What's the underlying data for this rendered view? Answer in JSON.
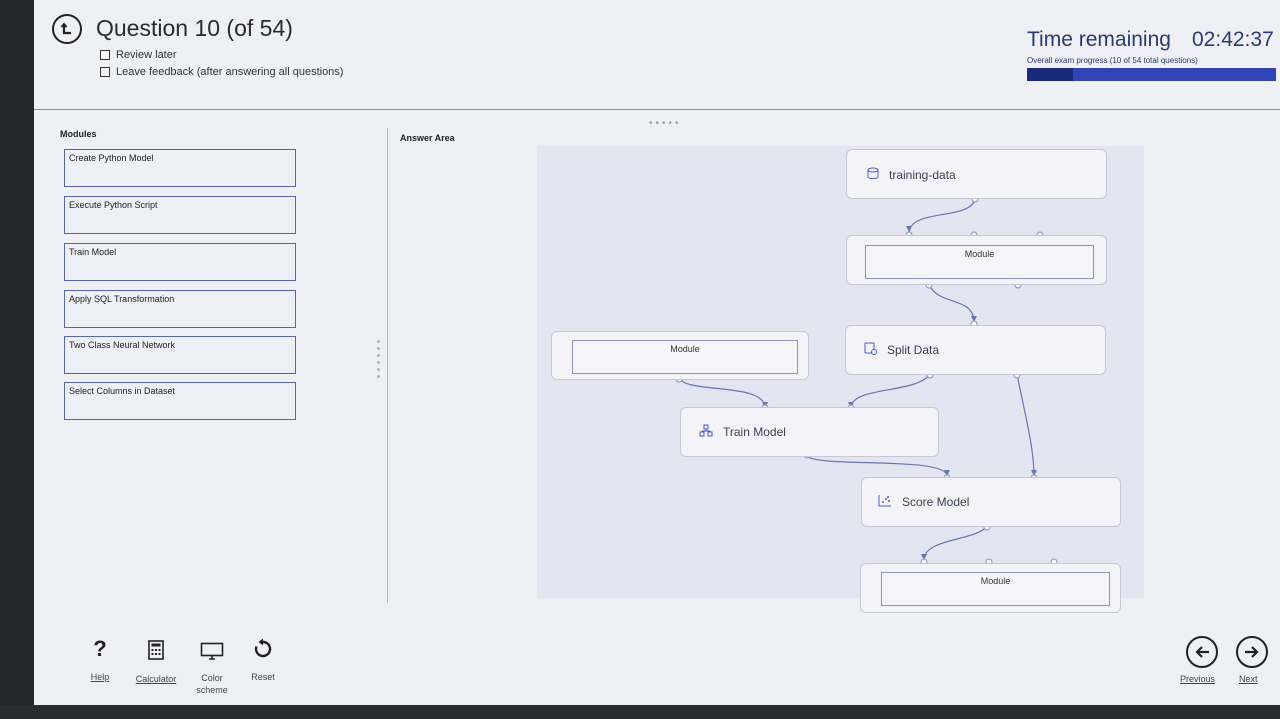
{
  "header": {
    "question_title": "Question 10 (of 54)",
    "review_later": "Review later",
    "leave_feedback": "Leave feedback (after answering all questions)",
    "time_label": "Time remaining",
    "time_value": "02:42:37",
    "progress_label": "Overall exam progress (10 of 54 total questions)",
    "progress_fraction": 0.185
  },
  "modules": {
    "label": "Modules",
    "items": [
      "Create Python Model",
      "Execute Python Script",
      "Train Model",
      "Apply SQL Transformation",
      "Two Class Neural Network",
      "Select Columns in Dataset"
    ]
  },
  "answer_area": {
    "label": "Answer Area",
    "nodes": {
      "training_data": "training-data",
      "module_top": "Module",
      "module_left": "Module",
      "split_data": "Split Data",
      "train_model": "Train Model",
      "score_model": "Score Model",
      "module_bottom": "Module"
    }
  },
  "toolbar": {
    "help": "Help",
    "calculator": "Calculator",
    "color_scheme": "Color scheme",
    "reset": "Reset"
  },
  "navigation": {
    "previous": "Previous",
    "next": "Next"
  },
  "colors": {
    "accent": "#2f45b5",
    "progress_done": "#1a2a7a"
  }
}
